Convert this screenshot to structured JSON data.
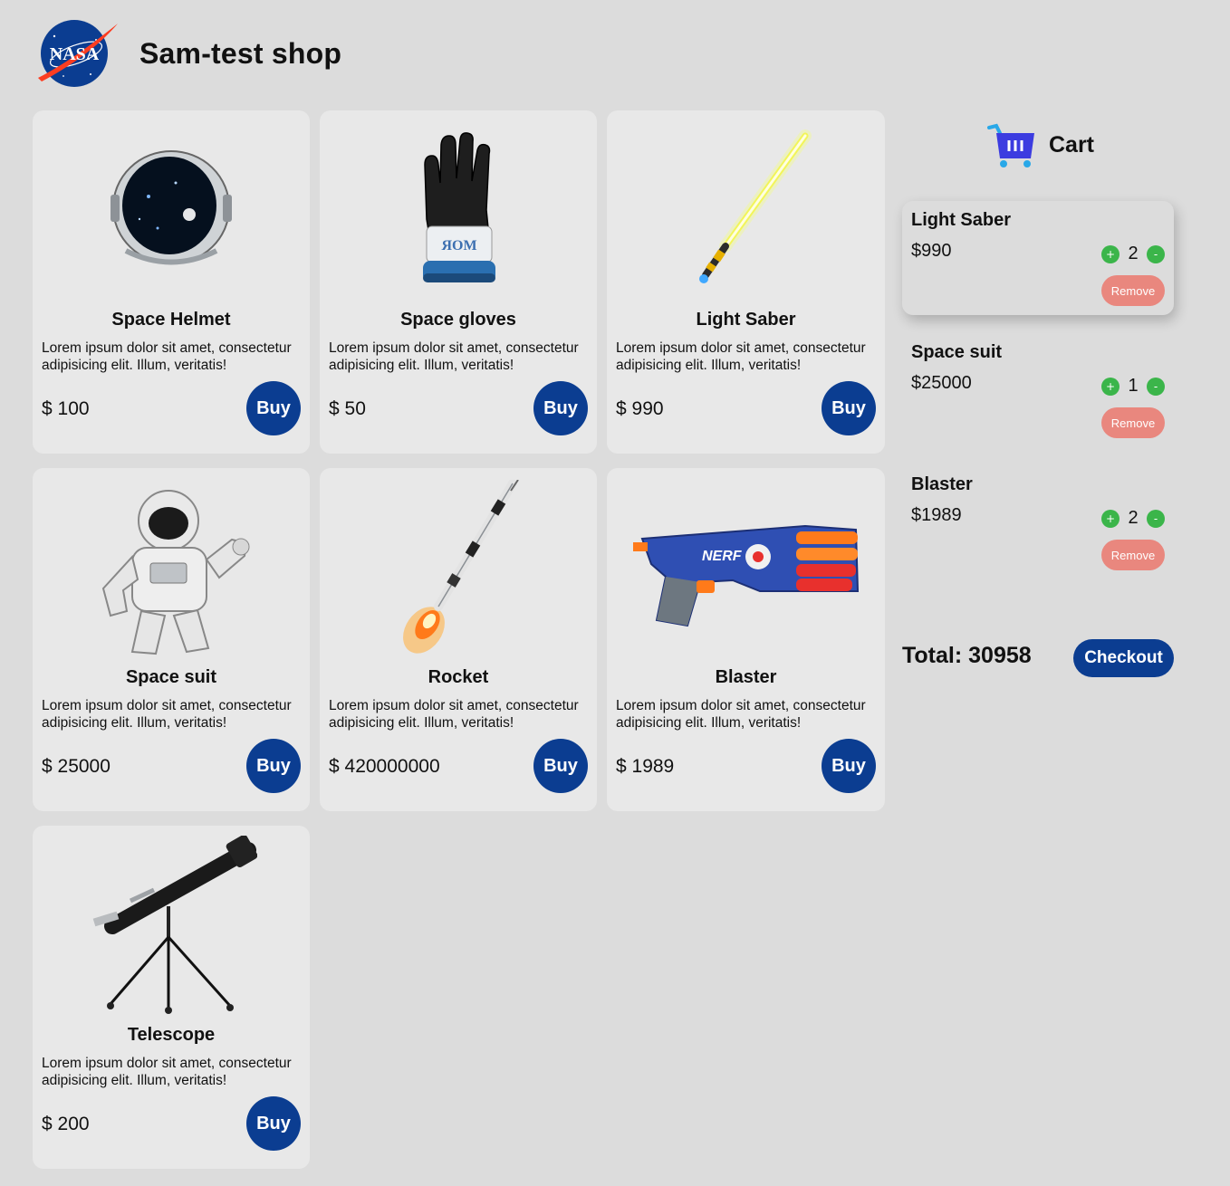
{
  "header": {
    "logo_text": "NASA",
    "title": "Sam-test shop"
  },
  "products": [
    {
      "name": "Space Helmet",
      "desc": "Lorem ipsum dolor sit amet, consectetur adipisicing elit. Illum, veritatis!",
      "price": "$ 100",
      "buy_label": "Buy",
      "icon": "space-helmet-image"
    },
    {
      "name": "Space gloves",
      "desc": "Lorem ipsum dolor sit amet, consectetur adipisicing elit. Illum, veritatis!",
      "price": "$ 50",
      "buy_label": "Buy",
      "icon": "space-gloves-image"
    },
    {
      "name": "Light Saber",
      "desc": "Lorem ipsum dolor sit amet, consectetur adipisicing elit. Illum, veritatis!",
      "price": "$ 990",
      "buy_label": "Buy",
      "icon": "light-saber-image"
    },
    {
      "name": "Space suit",
      "desc": "Lorem ipsum dolor sit amet, consectetur adipisicing elit. Illum, veritatis!",
      "price": "$ 25000",
      "buy_label": "Buy",
      "icon": "space-suit-image"
    },
    {
      "name": "Rocket",
      "desc": "Lorem ipsum dolor sit amet, consectetur adipisicing elit. Illum, veritatis!",
      "price": "$ 420000000",
      "buy_label": "Buy",
      "icon": "rocket-image"
    },
    {
      "name": "Blaster",
      "desc": "Lorem ipsum dolor sit amet, consectetur adipisicing elit. Illum, veritatis!",
      "price": "$ 1989",
      "buy_label": "Buy",
      "icon": "blaster-image"
    },
    {
      "name": "Telescope",
      "desc": "Lorem ipsum dolor sit amet, consectetur adipisicing elit. Illum, veritatis!",
      "price": "$ 200",
      "buy_label": "Buy",
      "icon": "telescope-image"
    }
  ],
  "cart": {
    "title": "Cart",
    "icon": "shopping-cart-icon",
    "items": [
      {
        "name": "Light Saber",
        "price": "$990",
        "qty": "2",
        "plus": "+",
        "minus": "-",
        "remove_label": "Remove"
      },
      {
        "name": "Space suit",
        "price": "$25000",
        "qty": "1",
        "plus": "+",
        "minus": "-",
        "remove_label": "Remove"
      },
      {
        "name": "Blaster",
        "price": "$1989",
        "qty": "2",
        "plus": "+",
        "minus": "-",
        "remove_label": "Remove"
      }
    ],
    "total_label": "Total: 30958",
    "checkout_label": "Checkout"
  },
  "colors": {
    "background": "#dcdcdc",
    "card": "#e8e8e8",
    "primary": "#0b3d91",
    "step_button": "#3bb54a",
    "remove_button": "#e9877e"
  }
}
